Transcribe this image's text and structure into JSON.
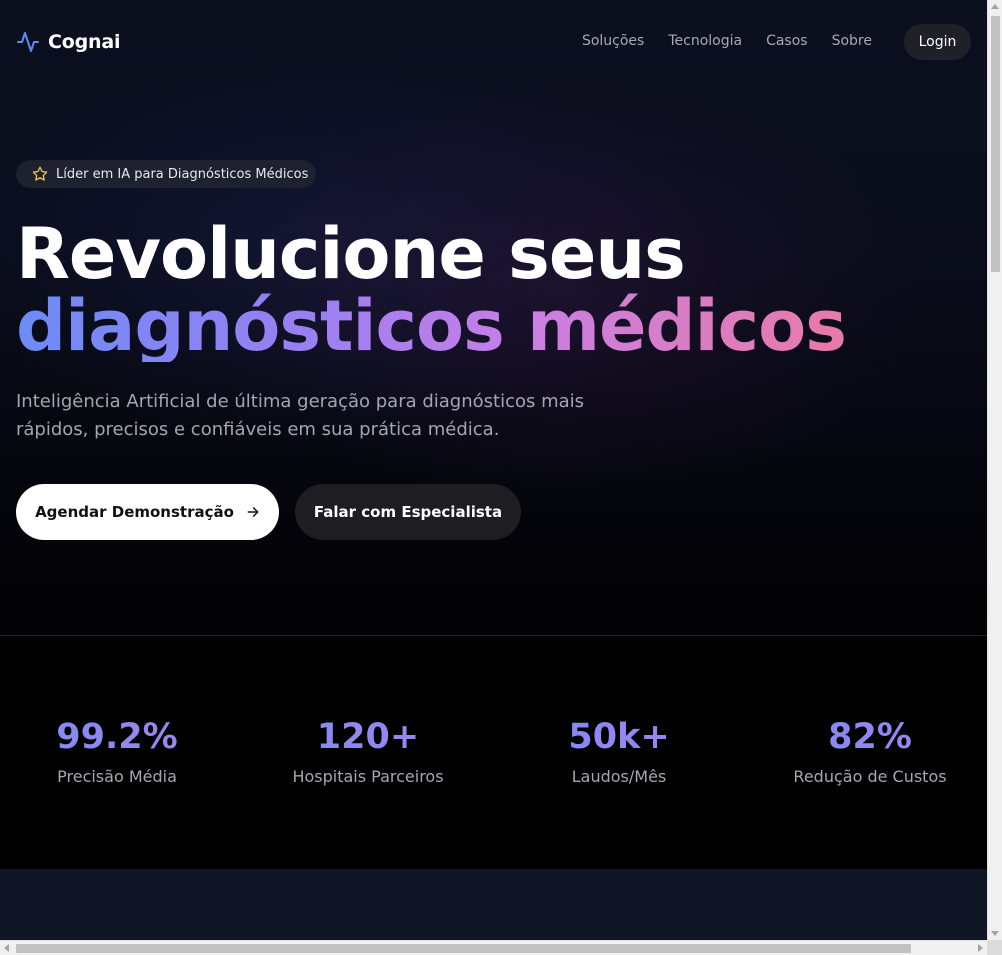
{
  "brand": {
    "name": "Cognai",
    "icon": "activity-pulse-icon",
    "accent": "#5b8cf5"
  },
  "nav": {
    "links": [
      "Soluções",
      "Tecnologia",
      "Casos",
      "Sobre"
    ],
    "login_label": "Login"
  },
  "hero": {
    "badge": {
      "icon": "star-icon",
      "text": "Líder em IA para Diagnósticos Médicos",
      "icon_color": "#f5c542"
    },
    "headline_line1": "Revolucione seus",
    "headline_line2": "diagnósticos médicos",
    "subtitle_line1": "Inteligência Artificial de última geração para diagnósticos mais",
    "subtitle_line2": "rápidos, precisos e confiáveis em sua prática médica.",
    "primary_cta": "Agendar Demonstração",
    "primary_cta_icon": "arrow-right-icon",
    "secondary_cta": "Falar com Especialista"
  },
  "stats": [
    {
      "value": "99.2%",
      "label": "Precisão Média"
    },
    {
      "value": "120+",
      "label": "Hospitais Parceiros"
    },
    {
      "value": "50k+",
      "label": "Laudos/Mês"
    },
    {
      "value": "82%",
      "label": "Redução de Custos"
    }
  ],
  "colors": {
    "gradient_start": "#6c8cf5",
    "gradient_mid": "#c77fe6",
    "gradient_end": "#e97aa8",
    "stat_gradient": "#8c88f1"
  }
}
